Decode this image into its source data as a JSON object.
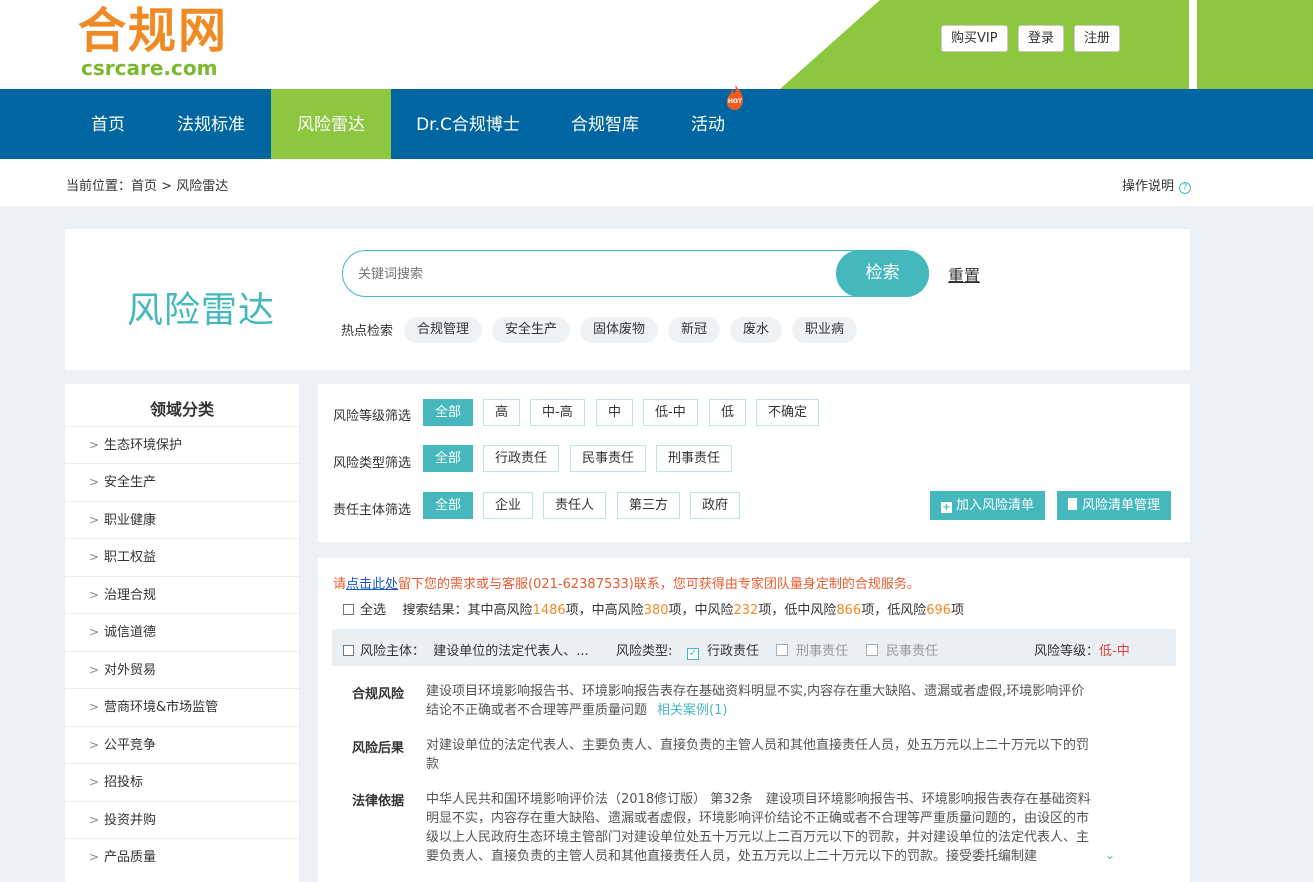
{
  "logo": {
    "cn": "合规网",
    "en": "csrcare.com"
  },
  "top_buttons": {
    "vip": "购买VIP",
    "login": "登录",
    "register": "注册"
  },
  "nav": {
    "items": [
      "首页",
      "法规标准",
      "风险雷达",
      "Dr.C合规博士",
      "合规智库",
      "活动"
    ],
    "active": "风险雷达",
    "hot_badge": "HOT"
  },
  "breadcrumb": {
    "prefix": "当前位置：",
    "home": "首页",
    "sep": ">",
    "current": "风险雷达"
  },
  "help_label": "操作说明",
  "search": {
    "title": "风险雷达",
    "placeholder": "关键词搜索",
    "button": "检索",
    "reset": "重置",
    "hot_label": "热点检索",
    "hot_tags": [
      "合规管理",
      "安全生产",
      "固体废物",
      "新冠",
      "废水",
      "职业病"
    ]
  },
  "sidebar": {
    "title": "领域分类",
    "items": [
      "生态环境保护",
      "安全生产",
      "职业健康",
      "职工权益",
      "治理合规",
      "诚信道德",
      "对外贸易",
      "营商环境&市场监管",
      "公平竞争",
      "招投标",
      "投资并购",
      "产品质量"
    ]
  },
  "filters": {
    "level": {
      "label": "风险等级筛选",
      "options": [
        "全部",
        "高",
        "中-高",
        "中",
        "低-中",
        "低",
        "不确定"
      ],
      "selected": "全部"
    },
    "type": {
      "label": "风险类型筛选",
      "options": [
        "全部",
        "行政责任",
        "民事责任",
        "刑事责任"
      ],
      "selected": "全部"
    },
    "subject": {
      "label": "责任主体筛选",
      "options": [
        "全部",
        "企业",
        "责任人",
        "第三方",
        "政府"
      ],
      "selected": "全部"
    },
    "add_button": "加入风险清单",
    "manage_button": "风险清单管理"
  },
  "results": {
    "notice_pre": "请",
    "notice_link": "点击此处",
    "notice_post": "留下您的需求或与客服(021-62387533)联系，您可获得由专家团队量身定制的合规服务。",
    "select_all": "全选",
    "summary_prefix": "搜索结果：其中高风险",
    "mid_high": "1486",
    "t1": "项，中高风险",
    "high_mid": "380",
    "t2": "项，中风险",
    "mid": "232",
    "t3": "项，低中风险",
    "low_mid": "866",
    "t4": "项，低风险",
    "low": "696",
    "t5": "项",
    "item": {
      "subject_label": "风险主体：",
      "subject_value": "建设单位的法定代表人、...",
      "type_label": "风险类型:",
      "types": [
        "行政责任",
        "刑事责任",
        "民事责任"
      ],
      "level_label": "风险等级：",
      "level_value": "低-中",
      "compliance_risk_label": "合规风险",
      "compliance_risk_text": "建设项目环境影响报告书、环境影响报告表存在基础资料明显不实,内容存在重大缺陷、遗漏或者虚假,环境影响评价结论不正确或者不合理等严重质量问题",
      "case_link": "相关案例(1)",
      "consequence_label": "风险后果",
      "consequence_text": "对建设单位的法定代表人、主要负责人、直接负责的主管人员和其他直接责任人员，处五万元以上二十万元以下的罚款",
      "legal_label": "法律依据",
      "legal_text": "中华人民共和国环境影响评价法（2018修订版） 第32条　建设项目环境影响报告书、环境影响报告表存在基础资料明显不实，内容存在重大缺陷、遗漏或者虚假，环境影响评价结论不正确或者不合理等严重质量问题的，由设区的市级以上人民政府生态环境主管部门对建设单位处五十万元以上二百万元以下的罚款，并对建设单位的法定代表人、主要负责人、直接负责的主管人员和其他直接责任人员，处五万元以上二十万元以下的罚款。接受委托编制建"
    }
  },
  "colors": {
    "brand_blue": "#0066a1",
    "brand_green": "#8dc63f",
    "teal": "#45b8bd",
    "orange": "#f08a24"
  }
}
